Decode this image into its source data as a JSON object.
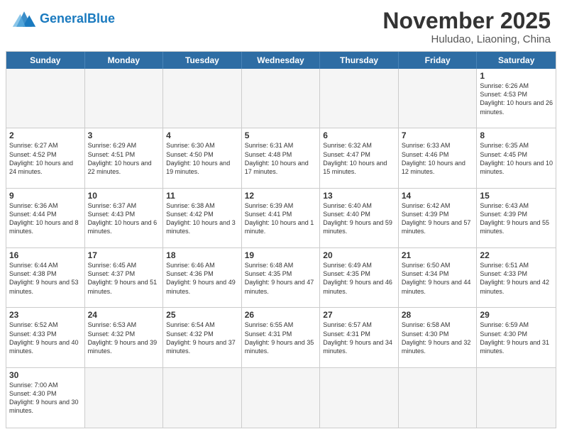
{
  "header": {
    "logo_general": "General",
    "logo_blue": "Blue",
    "month_title": "November 2025",
    "location": "Huludao, Liaoning, China"
  },
  "days": [
    "Sunday",
    "Monday",
    "Tuesday",
    "Wednesday",
    "Thursday",
    "Friday",
    "Saturday"
  ],
  "cells": [
    {
      "day": null,
      "empty": true
    },
    {
      "day": null,
      "empty": true
    },
    {
      "day": null,
      "empty": true
    },
    {
      "day": null,
      "empty": true
    },
    {
      "day": null,
      "empty": true
    },
    {
      "day": null,
      "empty": true
    },
    {
      "day": 1,
      "sunrise": "6:26 AM",
      "sunset": "4:53 PM",
      "daylight": "10 hours and 26 minutes."
    },
    {
      "day": 2,
      "sunrise": "6:27 AM",
      "sunset": "4:52 PM",
      "daylight": "10 hours and 24 minutes."
    },
    {
      "day": 3,
      "sunrise": "6:29 AM",
      "sunset": "4:51 PM",
      "daylight": "10 hours and 22 minutes."
    },
    {
      "day": 4,
      "sunrise": "6:30 AM",
      "sunset": "4:50 PM",
      "daylight": "10 hours and 19 minutes."
    },
    {
      "day": 5,
      "sunrise": "6:31 AM",
      "sunset": "4:48 PM",
      "daylight": "10 hours and 17 minutes."
    },
    {
      "day": 6,
      "sunrise": "6:32 AM",
      "sunset": "4:47 PM",
      "daylight": "10 hours and 15 minutes."
    },
    {
      "day": 7,
      "sunrise": "6:33 AM",
      "sunset": "4:46 PM",
      "daylight": "10 hours and 12 minutes."
    },
    {
      "day": 8,
      "sunrise": "6:35 AM",
      "sunset": "4:45 PM",
      "daylight": "10 hours and 10 minutes."
    },
    {
      "day": 9,
      "sunrise": "6:36 AM",
      "sunset": "4:44 PM",
      "daylight": "10 hours and 8 minutes."
    },
    {
      "day": 10,
      "sunrise": "6:37 AM",
      "sunset": "4:43 PM",
      "daylight": "10 hours and 6 minutes."
    },
    {
      "day": 11,
      "sunrise": "6:38 AM",
      "sunset": "4:42 PM",
      "daylight": "10 hours and 3 minutes."
    },
    {
      "day": 12,
      "sunrise": "6:39 AM",
      "sunset": "4:41 PM",
      "daylight": "10 hours and 1 minute."
    },
    {
      "day": 13,
      "sunrise": "6:40 AM",
      "sunset": "4:40 PM",
      "daylight": "9 hours and 59 minutes."
    },
    {
      "day": 14,
      "sunrise": "6:42 AM",
      "sunset": "4:39 PM",
      "daylight": "9 hours and 57 minutes."
    },
    {
      "day": 15,
      "sunrise": "6:43 AM",
      "sunset": "4:39 PM",
      "daylight": "9 hours and 55 minutes."
    },
    {
      "day": 16,
      "sunrise": "6:44 AM",
      "sunset": "4:38 PM",
      "daylight": "9 hours and 53 minutes."
    },
    {
      "day": 17,
      "sunrise": "6:45 AM",
      "sunset": "4:37 PM",
      "daylight": "9 hours and 51 minutes."
    },
    {
      "day": 18,
      "sunrise": "6:46 AM",
      "sunset": "4:36 PM",
      "daylight": "9 hours and 49 minutes."
    },
    {
      "day": 19,
      "sunrise": "6:48 AM",
      "sunset": "4:35 PM",
      "daylight": "9 hours and 47 minutes."
    },
    {
      "day": 20,
      "sunrise": "6:49 AM",
      "sunset": "4:35 PM",
      "daylight": "9 hours and 46 minutes."
    },
    {
      "day": 21,
      "sunrise": "6:50 AM",
      "sunset": "4:34 PM",
      "daylight": "9 hours and 44 minutes."
    },
    {
      "day": 22,
      "sunrise": "6:51 AM",
      "sunset": "4:33 PM",
      "daylight": "9 hours and 42 minutes."
    },
    {
      "day": 23,
      "sunrise": "6:52 AM",
      "sunset": "4:33 PM",
      "daylight": "9 hours and 40 minutes."
    },
    {
      "day": 24,
      "sunrise": "6:53 AM",
      "sunset": "4:32 PM",
      "daylight": "9 hours and 39 minutes."
    },
    {
      "day": 25,
      "sunrise": "6:54 AM",
      "sunset": "4:32 PM",
      "daylight": "9 hours and 37 minutes."
    },
    {
      "day": 26,
      "sunrise": "6:55 AM",
      "sunset": "4:31 PM",
      "daylight": "9 hours and 35 minutes."
    },
    {
      "day": 27,
      "sunrise": "6:57 AM",
      "sunset": "4:31 PM",
      "daylight": "9 hours and 34 minutes."
    },
    {
      "day": 28,
      "sunrise": "6:58 AM",
      "sunset": "4:30 PM",
      "daylight": "9 hours and 32 minutes."
    },
    {
      "day": 29,
      "sunrise": "6:59 AM",
      "sunset": "4:30 PM",
      "daylight": "9 hours and 31 minutes."
    },
    {
      "day": 30,
      "sunrise": "7:00 AM",
      "sunset": "4:30 PM",
      "daylight": "9 hours and 30 minutes."
    },
    {
      "day": null,
      "empty": true
    },
    {
      "day": null,
      "empty": true
    },
    {
      "day": null,
      "empty": true
    },
    {
      "day": null,
      "empty": true
    },
    {
      "day": null,
      "empty": true
    },
    {
      "day": null,
      "empty": true
    }
  ]
}
